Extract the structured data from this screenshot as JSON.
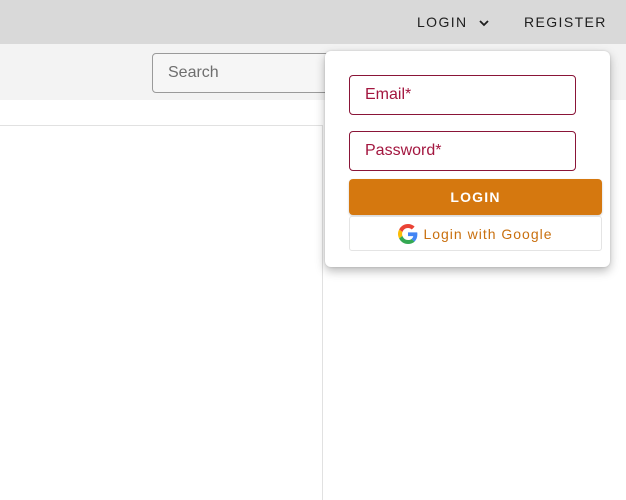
{
  "topbar": {
    "login_label": "LOGIN",
    "register_label": "REGISTER"
  },
  "search": {
    "placeholder": "Search"
  },
  "login_form": {
    "email_placeholder": "Email*",
    "password_placeholder": "Password*",
    "submit_label": "LOGIN",
    "google_label": "Login with Google"
  },
  "colors": {
    "topbar_bg": "#d9d9d9",
    "accent_orange": "#d5780f",
    "field_border": "#8a1538"
  },
  "icons": {
    "login_chevron": "chevron-down-icon",
    "google": "google-icon"
  }
}
